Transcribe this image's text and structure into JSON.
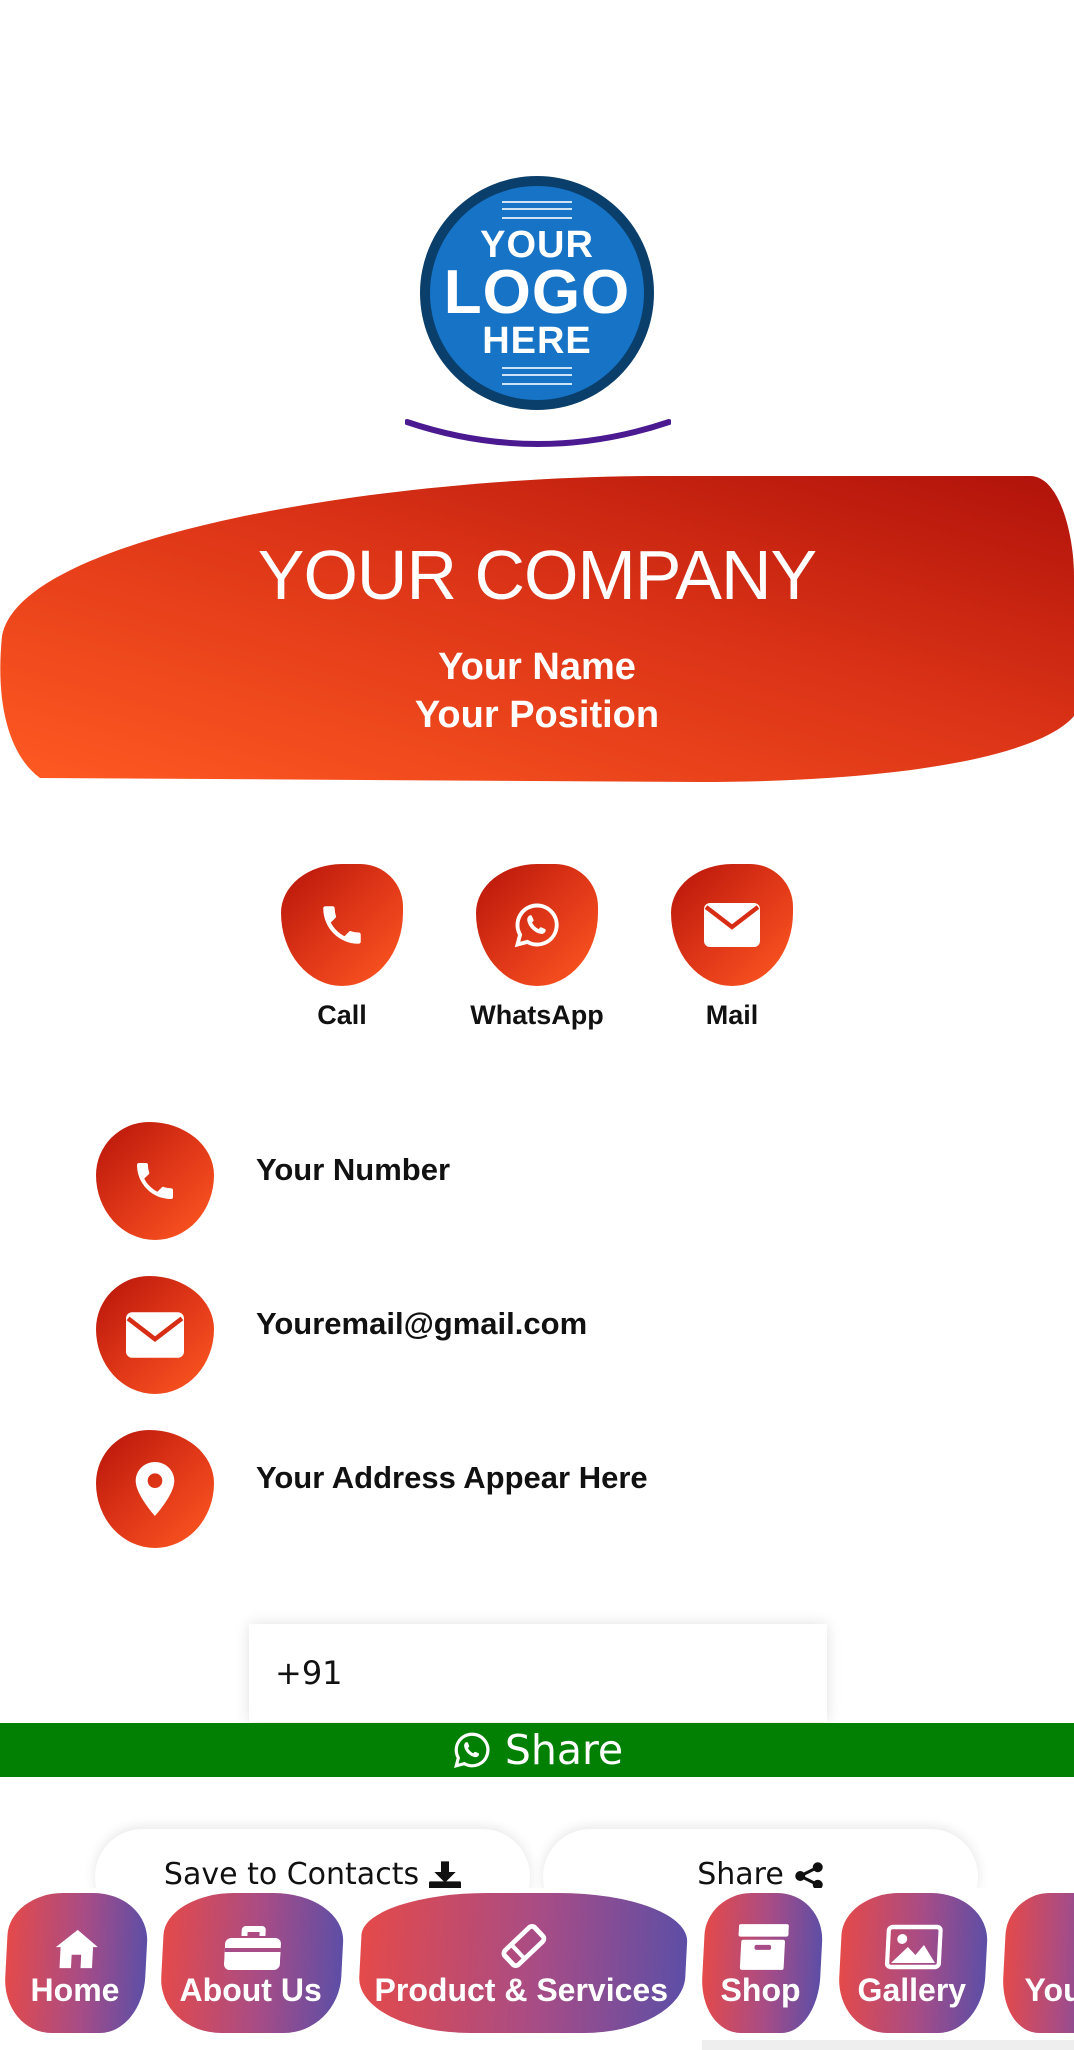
{
  "logo": {
    "line1": "YOUR",
    "line2": "LOGO",
    "line3": "HERE"
  },
  "header": {
    "company": "YOUR COMPANY",
    "name": "Your Name",
    "position": "Your Position"
  },
  "quick_actions": [
    {
      "label": "Call",
      "icon": "phone-icon"
    },
    {
      "label": "WhatsApp",
      "icon": "whatsapp-icon"
    },
    {
      "label": "Mail",
      "icon": "envelope-icon"
    }
  ],
  "contacts": [
    {
      "text": "Your Number",
      "icon": "phone-icon"
    },
    {
      "text": "Youremail@gmail.com",
      "icon": "envelope-icon"
    },
    {
      "text": "Your Address Appear Here",
      "icon": "map-pin-icon"
    }
  ],
  "share_form": {
    "phone_value": "+91",
    "button_label": "Share"
  },
  "actions": {
    "save_label": "Save to Contacts",
    "share_label": "Share"
  },
  "bottom_nav": [
    {
      "label": "Home",
      "icon": "home-icon"
    },
    {
      "label": "About Us",
      "icon": "briefcase-icon"
    },
    {
      "label": "Product & Services",
      "icon": "ticket-icon"
    },
    {
      "label": "Shop",
      "icon": "archive-box-icon"
    },
    {
      "label": "Gallery",
      "icon": "image-icon"
    },
    {
      "label": "You",
      "icon": ""
    }
  ],
  "colors": {
    "brand_red": "#d62d14",
    "brand_orange": "#ff5a22",
    "whatsapp_green": "#028003",
    "logo_blue": "#1673c6",
    "arc_purple": "#4b1a91"
  }
}
